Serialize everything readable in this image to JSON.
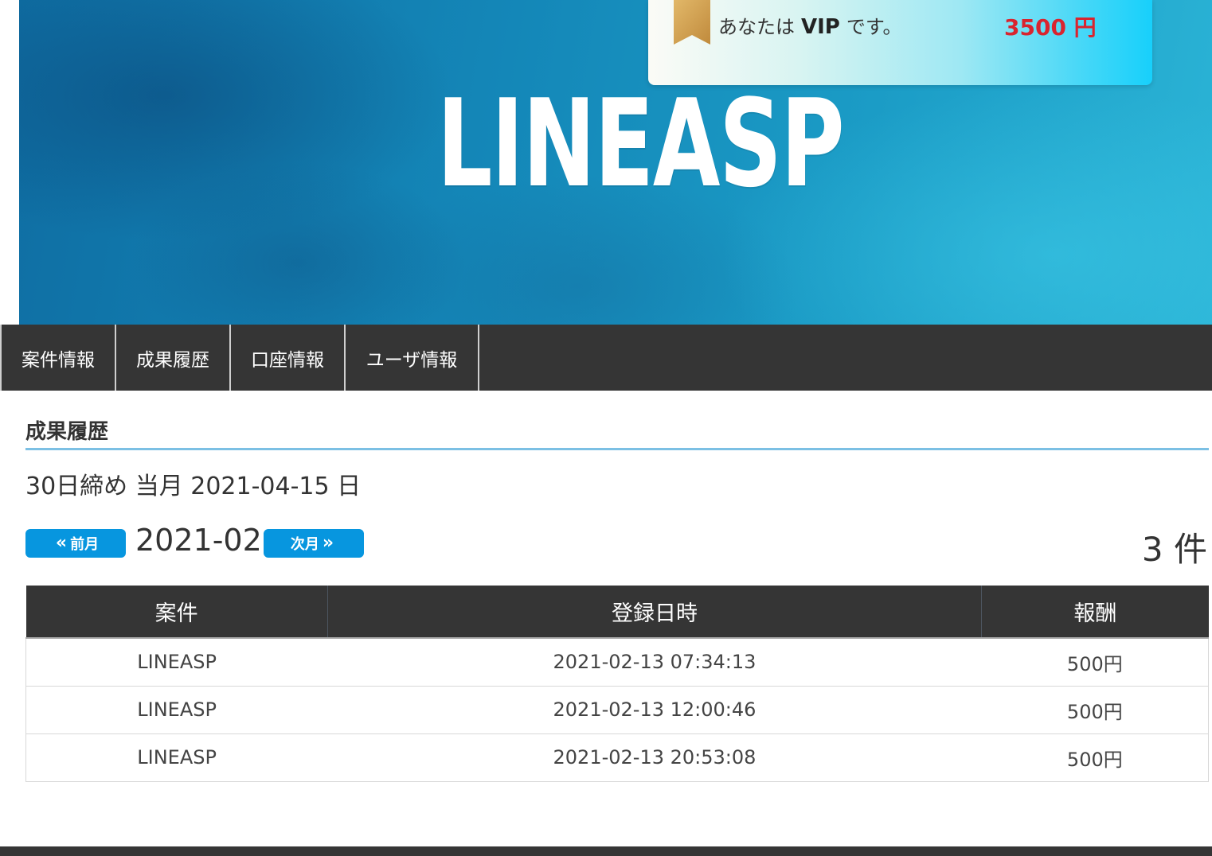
{
  "hero": {
    "logo_text": "LINEASP"
  },
  "vip": {
    "prefix": "あなたは",
    "rank": "VIP",
    "suffix": "です。",
    "amount": "3500 円",
    "ribbon_color": "#d4a556"
  },
  "nav": {
    "items": [
      {
        "label": "案件情報"
      },
      {
        "label": "成果履歴"
      },
      {
        "label": "口座情報"
      },
      {
        "label": "ユーザ情報"
      }
    ]
  },
  "page": {
    "title": "成果履歴",
    "closing_info": "30日締め 当月 2021-04-15 日"
  },
  "month_nav": {
    "prev_label": "前月",
    "next_label": "次月",
    "current_month": "2021-02",
    "count": "3 件"
  },
  "table": {
    "headers": [
      "案件",
      "登録日時",
      "報酬"
    ],
    "rows": [
      {
        "case": "LINEASP",
        "date": "2021-02-13 07:34:13",
        "reward": "500円"
      },
      {
        "case": "LINEASP",
        "date": "2021-02-13 12:00:46",
        "reward": "500円"
      },
      {
        "case": "LINEASP",
        "date": "2021-02-13 20:53:08",
        "reward": "500円"
      }
    ]
  },
  "colors": {
    "nav_bg": "#353535",
    "accent_blue": "#0796df",
    "rule_blue": "#7cc0e4",
    "amount_red": "#d9242f"
  }
}
